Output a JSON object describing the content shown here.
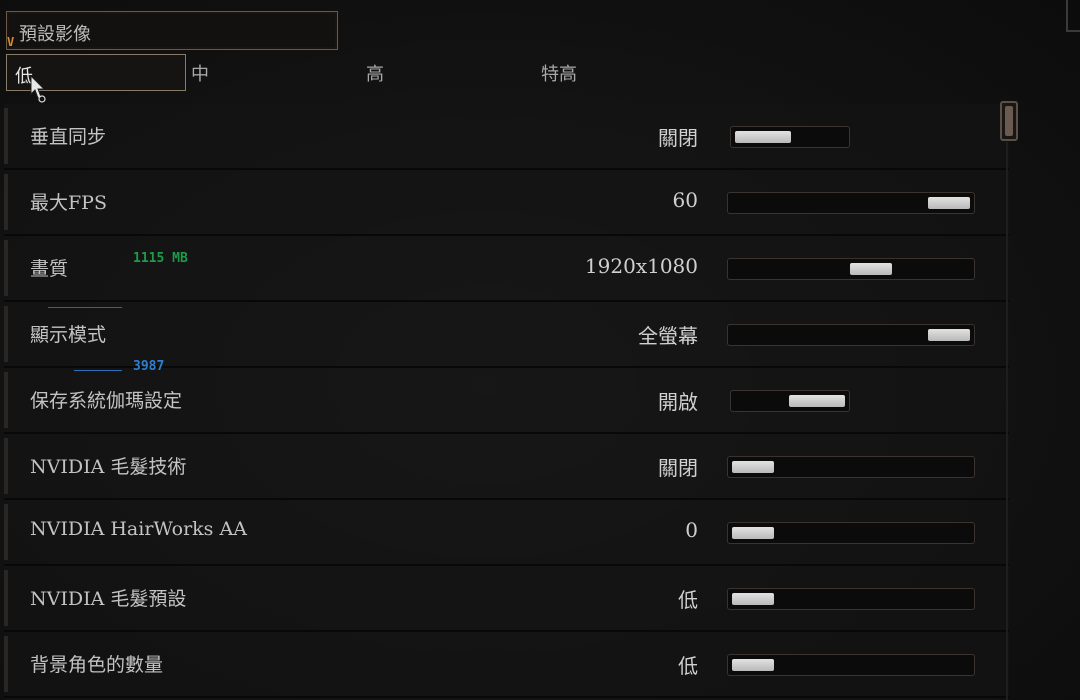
{
  "preset": {
    "label": "預設影像",
    "marker": "V",
    "options": [
      "低",
      "中",
      "高",
      "特高"
    ],
    "selected": "低"
  },
  "overlay": {
    "memory": "1115 MB",
    "counter": "3987"
  },
  "settings": [
    {
      "label": "垂直同步",
      "value": "關閉"
    },
    {
      "label": "最大FPS",
      "value": "60"
    },
    {
      "label": "畫質",
      "value": "1920x1080"
    },
    {
      "label": "顯示模式",
      "value": "全螢幕"
    },
    {
      "label": "保存系統伽瑪設定",
      "value": "開啟"
    },
    {
      "label": "NVIDIA 毛髮技術",
      "value": "關閉"
    },
    {
      "label": "NVIDIA HairWorks AA",
      "value": "0"
    },
    {
      "label": "NVIDIA 毛髮預設",
      "value": "低"
    },
    {
      "label": "背景角色的數量",
      "value": "低"
    }
  ],
  "slider_levels": [
    0.0,
    1.0,
    0.6,
    1.0,
    1.0,
    0.0,
    0.0,
    0.0,
    0.0
  ],
  "colors": {
    "accent_orange": "#e08a2a",
    "overlay_green": "#1f9a4a",
    "overlay_blue": "#2f7fd0"
  },
  "icons": {
    "cursor": "hand-pointer-icon"
  }
}
